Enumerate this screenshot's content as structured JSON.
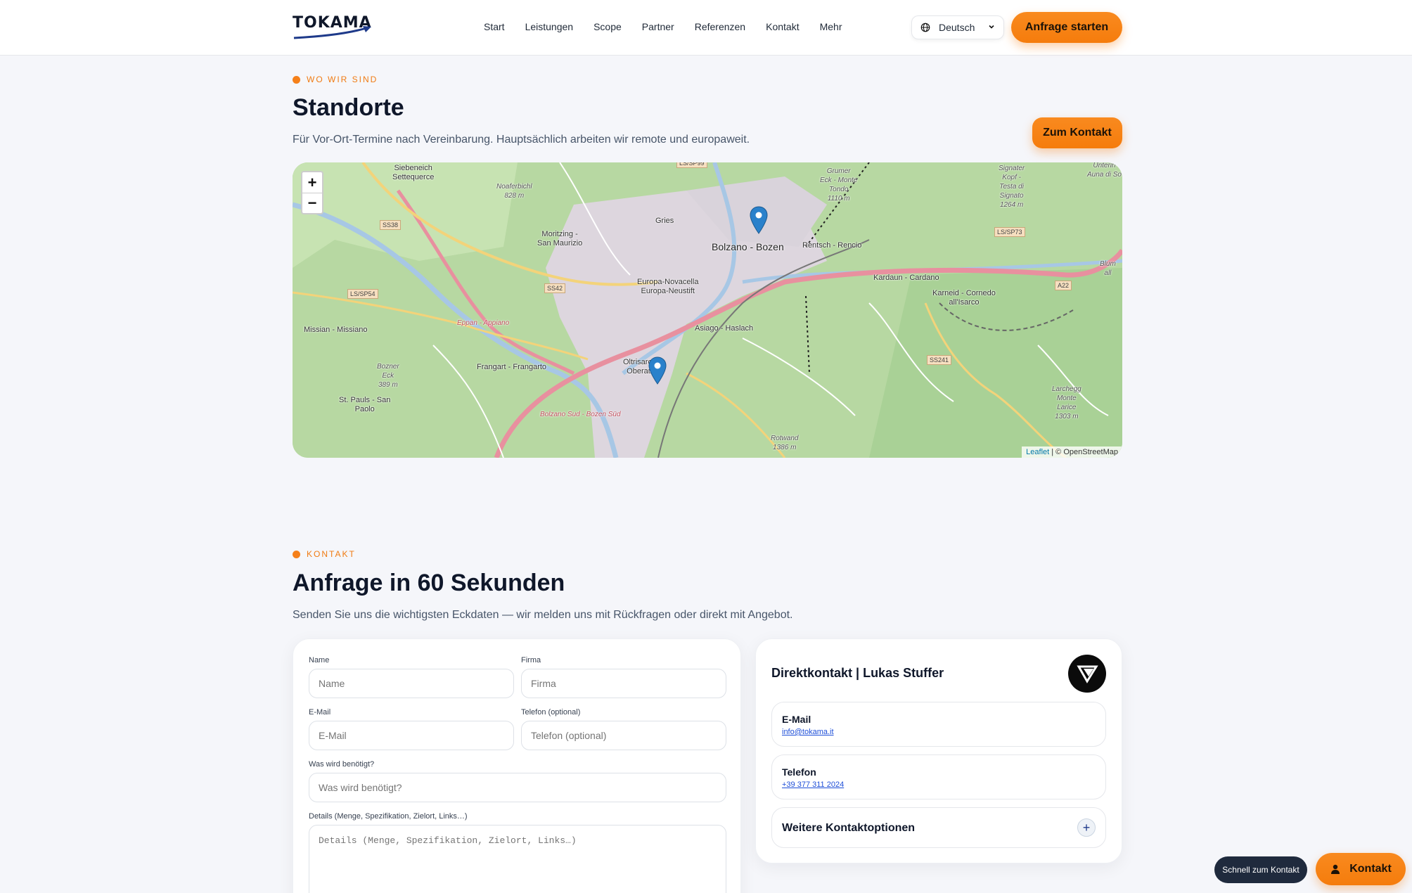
{
  "brand": {
    "name": "TOKAMA"
  },
  "nav": {
    "items": [
      "Start",
      "Leistungen",
      "Scope",
      "Partner",
      "Referenzen",
      "Kontakt",
      "Mehr"
    ]
  },
  "language": {
    "selected": "Deutsch"
  },
  "header": {
    "cta_label": "Anfrage starten"
  },
  "locations": {
    "eyebrow": "WO WIR SIND",
    "title": "Standorte",
    "subtitle": "Für Vor-Ort-Termine nach Vereinbarung. Hauptsächlich arbeiten wir remote und europaweit.",
    "cta_label": "Zum Kontakt",
    "map": {
      "zoom_in": "+",
      "zoom_out": "−",
      "attribution_leaflet": "Leaflet",
      "attribution_osm": "| © OpenStreetMap",
      "labels": {
        "siebeneich": "Siebeneich\nSettequerce",
        "noafer": "Noaferbichl\n828 m",
        "gries": "Gries",
        "moritzing": "Moritzing -\nSan Maurizio",
        "bolzano": "Bolzano - Bozen",
        "europa": "Europa-Novacella\nEuropa-Neustift",
        "rentsch": "Rentsch - Rencio",
        "kardaun": "Kardaun - Cardano",
        "karneid": "Karneid - Cornedo\nall'Isarco",
        "missian": "Missian - Missiano",
        "eppan": "Eppan - Appiano",
        "asiago": "Asiago - Haslach",
        "frangart": "Frangart - Frangarto",
        "oltrisarco": "Oltrisarco\nOberau",
        "bozner": "Bozner\nEck\n389 m",
        "stpauls": "St. Pauls - San\nPaolo",
        "bolzanosud": "Bolzano Sud - Bozen Süd",
        "rotwand": "Rotwand\n1386 m",
        "grumer": "Grumer\nEck - Monte\nTondo\n1110 m",
        "signater": "Signater\nKopf -\nTesta di\nSignato\n1264 m",
        "unterinn": "Unterin\nAuna di So",
        "larcheg": "Larchegg\nMonte\nLarice\n1303 m",
        "blum": "Blum\nall"
      },
      "shields": [
        "SS38",
        "LS/SP54",
        "SS42",
        "LS/SP73",
        "A22",
        "SS241",
        "LS/SP99"
      ]
    }
  },
  "contact": {
    "eyebrow": "KONTAKT",
    "title": "Anfrage in 60 Sekunden",
    "subtitle": "Senden Sie uns die wichtigsten Eckdaten — wir melden uns mit Rückfragen oder direkt mit Angebot.",
    "form": {
      "name_label": "Name",
      "name_placeholder": "Name",
      "company_label": "Firma",
      "company_placeholder": "Firma",
      "email_label": "E-Mail",
      "email_placeholder": "E-Mail",
      "phone_label": "Telefon (optional)",
      "phone_placeholder": "Telefon (optional)",
      "need_label": "Was wird benötigt?",
      "need_placeholder": "Was wird benötigt?",
      "details_label": "Details (Menge, Spezifikation, Zielort, Links…)",
      "details_placeholder": "Details (Menge, Spezifikation, Zielort, Links…)"
    },
    "direct": {
      "title": "Direktkontakt | Lukas Stuffer",
      "email_title": "E-Mail",
      "email_value": "info@tokama.it",
      "phone_title": "Telefon",
      "phone_value": "+39 377 311 2024",
      "more_title": "Weitere Kontaktoptionen"
    }
  },
  "floating": {
    "quick_label": "Schnell zum Kontakt",
    "kontakt_label": "Kontakt"
  },
  "colors": {
    "accent": "#f57c0c",
    "text": "#0f172a",
    "link": "#1d4ed8",
    "page_bg": "#f5f6fa"
  }
}
